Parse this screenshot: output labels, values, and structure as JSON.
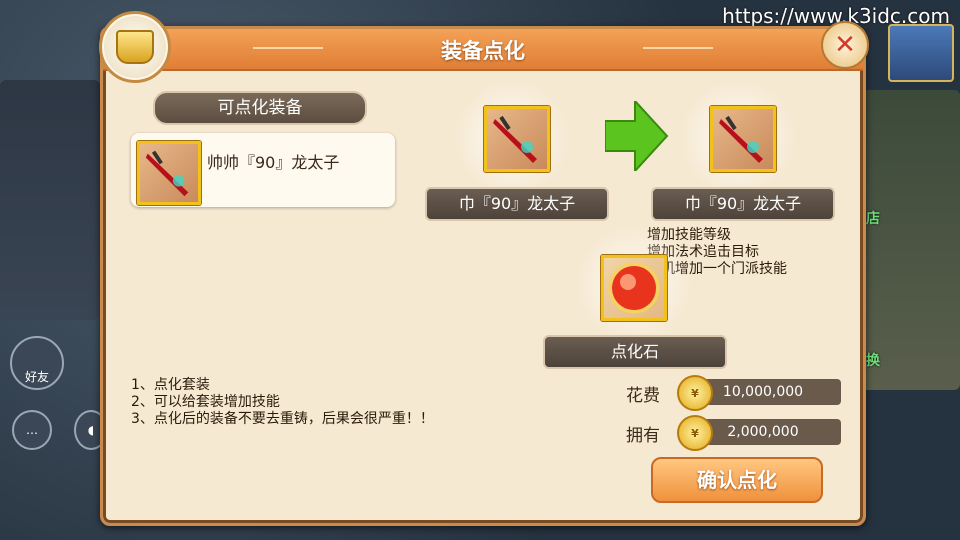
{
  "watermark": "https://www.k3idc.com",
  "background": {
    "friends_label": "好友",
    "right_tag_1": "店",
    "right_tag_2": "换"
  },
  "panel": {
    "title": "装备点化",
    "list_header": "可点化装备",
    "equipment_list": [
      {
        "name": "帅帅『90』龙太子",
        "icon": "red-sword-icon"
      }
    ],
    "source_item_label": "巾『90』龙太子",
    "result_item_label": "巾『90』龙太子",
    "effects": [
      "增加技能等级",
      "增加法术追击目标",
      "随机增加一个门派技能"
    ],
    "stone_label": "点化石",
    "notes": [
      "1、点化套装",
      "2、可以给套装增加技能",
      "3、点化后的装备不要去重铸，后果会很严重！！"
    ],
    "cost_label": "花费",
    "cost_value": "10,000,000",
    "own_label": "拥有",
    "own_value": "2,000,000",
    "confirm_button": "确认点化"
  },
  "colors": {
    "panel_bg": "#f6e9d2",
    "title_bar": "#e98a3e",
    "slot_border": "#f2c21a",
    "arrow": "#5cc41e"
  }
}
